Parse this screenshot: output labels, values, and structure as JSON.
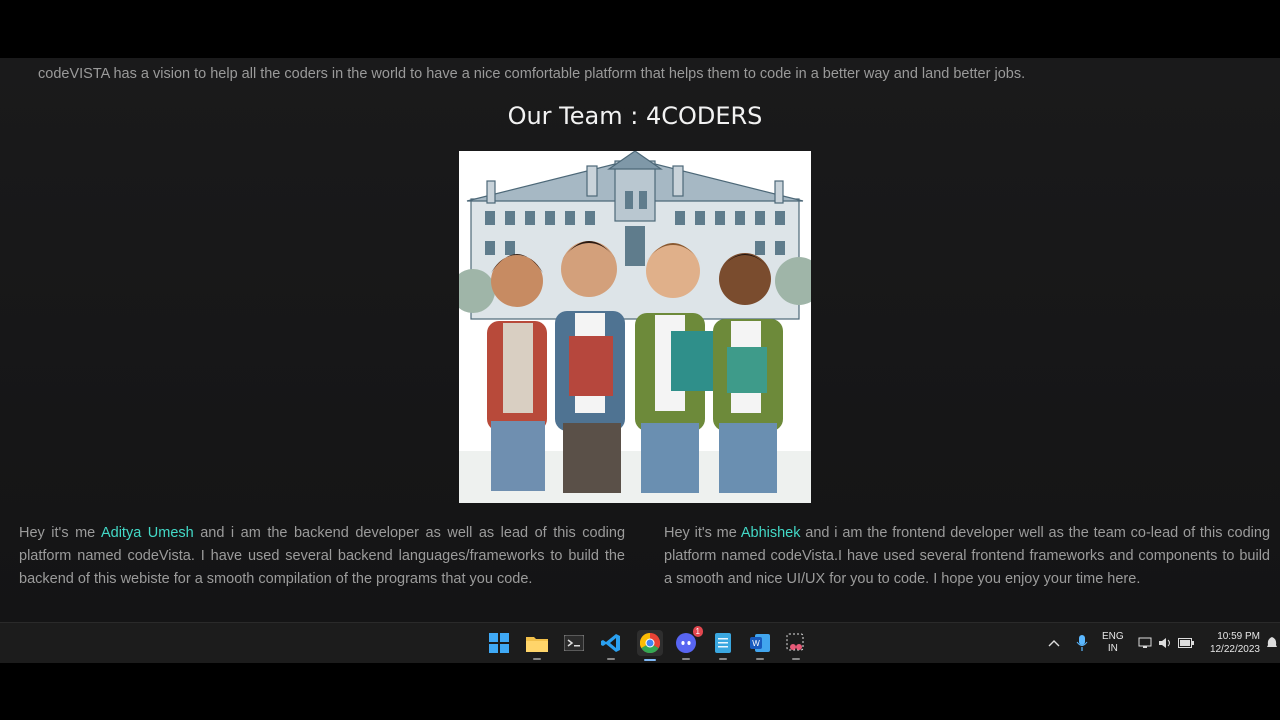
{
  "page": {
    "vision_text": "codeVISTA has a vision to help all the coders in the world to have a nice comfortable platform that helps them to code in a better way and land better jobs.",
    "team_title": "Our Team : 4CODERS"
  },
  "bios": {
    "left": {
      "prefix": "Hey it's me ",
      "name": "Aditya Umesh",
      "text": " and i am the backend developer as well as lead of this coding platform named codeVista. I have used several backend languages/frameworks to build the backend of this webiste for a smooth compilation of the programs that you code."
    },
    "right": {
      "prefix": "Hey it's me ",
      "name": "Abhishek",
      "text": " and i am the frontend developer well as the team co-lead of this coding platform named codeVista.I have used several frontend frameworks and components to build a smooth and nice UI/UX for you to code. I hope you enjoy your time here."
    }
  },
  "taskbar": {
    "apps": [
      "windows-start",
      "file-explorer",
      "terminal",
      "vs-code",
      "chrome",
      "discord",
      "notepad",
      "word",
      "snipping-tool"
    ],
    "discord_badge": "1",
    "lang_top": "ENG",
    "lang_bottom": "IN",
    "time": "10:59 PM",
    "date": "12/22/2023"
  },
  "colors": {
    "accent": "#43d9c7",
    "text": "#9b9b9b",
    "background": "#161617"
  }
}
